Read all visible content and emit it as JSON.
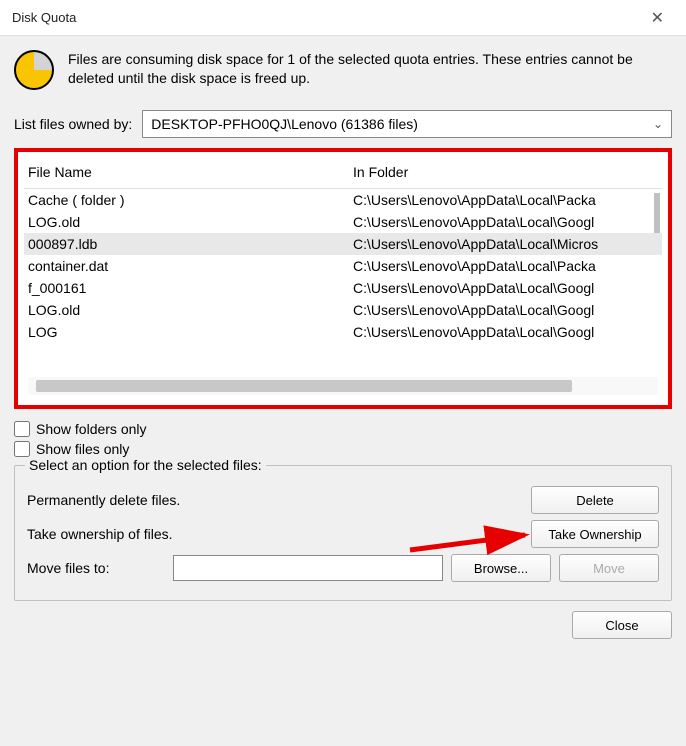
{
  "window": {
    "title": "Disk Quota",
    "close": "✕"
  },
  "info": "Files are consuming disk space for 1 of the selected quota entries.  These entries cannot be deleted until the disk space is freed up.",
  "filter": {
    "label": "List files owned by:",
    "selected": "DESKTOP-PFHO0QJ\\Lenovo (61386 files)"
  },
  "columns": {
    "name": "File Name",
    "folder": "In Folder"
  },
  "rows": [
    {
      "name": "Cache  ( folder )",
      "folder": "C:\\Users\\Lenovo\\AppData\\Local\\Packa",
      "selected": false
    },
    {
      "name": "LOG.old",
      "folder": "C:\\Users\\Lenovo\\AppData\\Local\\Googl",
      "selected": false
    },
    {
      "name": "000897.ldb",
      "folder": "C:\\Users\\Lenovo\\AppData\\Local\\Micros",
      "selected": true
    },
    {
      "name": "container.dat",
      "folder": "C:\\Users\\Lenovo\\AppData\\Local\\Packa",
      "selected": false
    },
    {
      "name": "f_000161",
      "folder": "C:\\Users\\Lenovo\\AppData\\Local\\Googl",
      "selected": false
    },
    {
      "name": "LOG.old",
      "folder": "C:\\Users\\Lenovo\\AppData\\Local\\Googl",
      "selected": false
    },
    {
      "name": "LOG",
      "folder": "C:\\Users\\Lenovo\\AppData\\Local\\Googl",
      "selected": false
    }
  ],
  "checks": {
    "folders_only": "Show folders only",
    "files_only": "Show files only"
  },
  "group": {
    "legend": "Select an option for the selected files:",
    "perm_delete": "Permanently delete files.",
    "delete_btn": "Delete",
    "take_own": "Take ownership of files.",
    "take_own_btn": "Take Ownership",
    "move_to": "Move files to:",
    "browse_btn": "Browse...",
    "move_btn": "Move"
  },
  "footer": {
    "close_btn": "Close"
  }
}
